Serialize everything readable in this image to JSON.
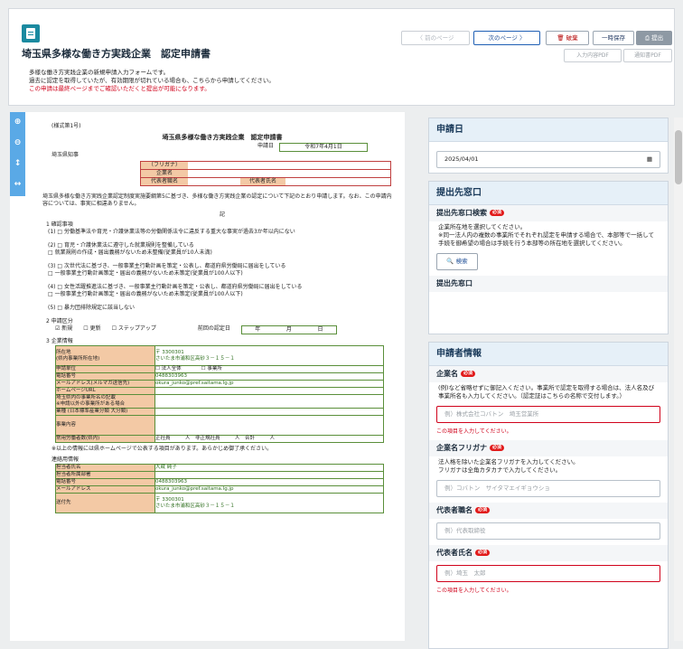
{
  "header": {
    "title": "埼玉県多様な働き方実践企業　認定申請書",
    "desc_lines": [
      "多様な働き方実践企業の新規申請入力フォームです。",
      "過去に認定を取得していたが、有効期限が切れている場合も、こちらから申請してください。"
    ],
    "desc_red": "この申請は最終ページまでご確認いただくと提出が可能になります。",
    "toolbar": {
      "prev": "〈  前のページ",
      "next": "次のページ 〉",
      "discard": "破棄",
      "temp_save": "一時保存",
      "submit": "提出",
      "pdf_input": "入力内容PDF",
      "pdf_notice": "通知書PDF"
    }
  },
  "doc": {
    "form_no": "(様式第1号)",
    "title": "埼玉県多様な働き方実践企業　認定申請書",
    "date_label": "申請日",
    "date_value": "令和7年4月1日",
    "addressee": "埼玉県知事",
    "furigana": "（フリガナ）",
    "company": "企業名",
    "rep_title": "代表者職名",
    "rep_name": "代表者氏名",
    "intro": "埼玉県多様な働き方実践企業認定制度実施要綱第5に基づき、多様な働き方実践企業の認定について下記のとおり申請します。なお、この申請内容については、事実に相違ありません。",
    "ki": "記",
    "sec1": "1  確認事項",
    "items": [
      "(1)  □ 労働基準法や育児・介護休業法等の労働関係法令に違反する重大な事実が過去3か年以内にない",
      "(2)  □ 育児・介護休業法に遵守した就業規則を整備している",
      "       □ 就業規則の作成・届出義務がないため未整備(従業員が10人未満)",
      "(3)  □ 次世代法に基づき、一般事業主行動計画を策定・公表し、都道府県労働局に届出をしている",
      "       □ 一般事業主行動計画策定・届出の義務がないため未策定(従業員が100人以下)",
      "(4)  □ 女性活躍推進法に基づき、一般事業主行動計画を策定・公表し、都道府県労働局に届出をしている",
      "       □ 一般事業主行動計画策定・届出の義務がないため未策定(従業員が100人以下)",
      "(5)  □ 暴力団排除規定に該当しない"
    ],
    "sec2": "2  申請区分",
    "class_opts": [
      "☑ 新規",
      "☐ 更新",
      "☐ ステップアップ"
    ],
    "prev_date": "前回の認定日",
    "ymd": [
      "年",
      "月",
      "日"
    ],
    "sec3": "3  企業情報",
    "info_rows": [
      {
        "label": "所在地\n(県内事業所所在地)",
        "value": "〒 3300301\nさいたま市浦和区高砂３－１５－１"
      },
      {
        "label": "申請単位",
        "value": "☐ 法人全体　　　　☐ 事業所"
      },
      {
        "label": "電話番号",
        "value": "0488303963"
      },
      {
        "label": "メールアドレス(メルマガ送信先)",
        "value": "okura_junko@pref.saitama.lg.jp"
      },
      {
        "label": "ホームページURL",
        "value": ""
      },
      {
        "label": "埼玉県内の事業所名の記載\n※申請以外の事業所がある場合",
        "value": ""
      },
      {
        "label": "業種 (日本標準産業分類 大分類)",
        "value": ""
      },
      {
        "label": "事業内容",
        "value": ""
      },
      {
        "label": "常用労働者数(県内)",
        "value": "正社員　　　人　非正規社員　　　人　合計　　　人"
      }
    ],
    "note": "※以上の情報には県ホームページで公表する項目があります。あらかじめ御了承ください。",
    "sec4": "連絡用情報",
    "contact_rows": [
      {
        "label": "担当者氏名",
        "value": "大蔵 純子"
      },
      {
        "label": "担当者所属部署",
        "value": ""
      },
      {
        "label": "電話番号",
        "value": "0488303963"
      },
      {
        "label": "メールアドレス",
        "value": "okura_junko@pref.saitama.lg.jp"
      },
      {
        "label": "送付先",
        "value": "〒 3300301\nさいたま市浦和区高砂３－１５－１"
      }
    ]
  },
  "right": {
    "date_card": {
      "title": "申請日",
      "value": "2025/04/01"
    },
    "office_card": {
      "title": "提出先窓口",
      "search_label": "提出先窓口検索",
      "req": "必須",
      "help": "企業所在地を選択してください。\n※同一法人内の複数の事業所でそれぞれ認定を申請する場合で、本部等で一括して手続を御希望の場合は手続を行う本部等の所在地を選択してください。",
      "search_btn": "検索",
      "result_label": "提出先窓口"
    },
    "applicant_card": {
      "title": "申請者情報",
      "company_label": "企業名",
      "company_help": "(例)など省略せずに御記入ください。事業所で認定を取得する場合は、法人名及び事業所名も入力してください。（認定証はこちらの名称で交付します。）",
      "company_ph": "例）株式会社コバトン　埼玉営業所",
      "error": "この項目を入力してください。",
      "furigana_label": "企業名フリガナ",
      "furigana_help": "法人格を除いた企業名フリガナを入力してください。\nフリガナは全角カタカナで入力してください。",
      "furigana_ph": "例）コバトン　サイタマエイギョウショ",
      "rep_title_label": "代表者職名",
      "rep_title_ph": "例）代表取締役",
      "rep_name_label": "代表者氏名",
      "rep_name_ph": "例）埼玉　太郎"
    },
    "req": "必須"
  }
}
